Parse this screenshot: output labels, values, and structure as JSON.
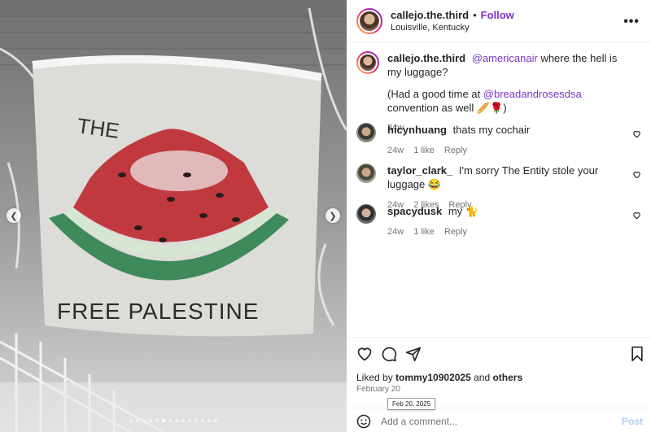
{
  "post": {
    "username": "callejo.the.third",
    "separator": "•",
    "follow_label": "Follow",
    "location": "Louisville, Kentucky",
    "more_icon": "more-horizontal-icon",
    "image_alt": "Snow-covered banner with a painted watermelon and the words FREE PALESTINE",
    "banner_text_top": "THE",
    "banner_text_bottom": "FREE PALESTINE"
  },
  "caption": {
    "username": "callejo.the.third",
    "mention": "@americanair",
    "text": " where the hell is my luggage?",
    "line2_prefix": "(Had a good time at ",
    "line2_mention": "@breadandrosesdsa",
    "line2_suffix": " convention as well 🥖🌹)",
    "time": "24w"
  },
  "comments": [
    {
      "username": "hicynhuang",
      "text": "thats my cochair",
      "time": "24w",
      "likes": "1 like",
      "reply": "Reply"
    },
    {
      "username": "taylor_clark_",
      "text": "I'm sorry The Entity stole your luggage 😂",
      "time": "24w",
      "likes": "2 likes",
      "reply": "Reply"
    },
    {
      "username": "spacydusk",
      "text": "my 🐈",
      "time": "24w",
      "likes": "1 like",
      "reply": "Reply"
    }
  ],
  "actions": {
    "liked_by_prefix": "Liked by ",
    "liked_by_user": "tommy10902025",
    "liked_by_and": " and ",
    "liked_by_others": "others",
    "date": "February 20",
    "tooltip": "Feb 20, 2025",
    "comment_placeholder": "Add a comment...",
    "post_label": "Post"
  },
  "carousel": {
    "total": 14,
    "active": 5
  },
  "colors": {
    "accent": "#7a35c7",
    "post_disabled": "#b3cdf8",
    "muted": "#737373"
  }
}
